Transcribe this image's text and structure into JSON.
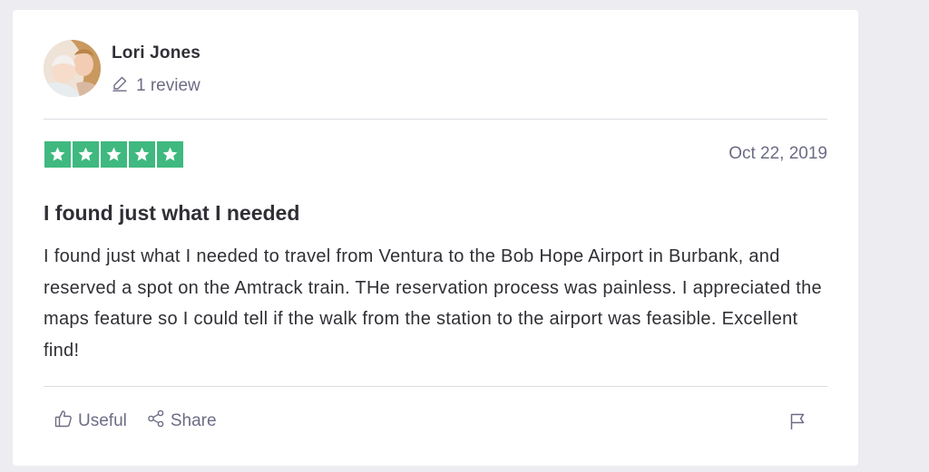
{
  "reviewer": {
    "name": "Lori Jones",
    "review_count": "1 review"
  },
  "rating": {
    "stars": 5,
    "max_stars": 5,
    "color": "#3fb97f"
  },
  "review": {
    "date": "Oct 22, 2019",
    "title": "I found just what I needed",
    "body": "I found just what I needed to travel from Ventura to the Bob Hope Airport in Burbank, and reserved a spot on the Amtrack train. THe reservation process was painless. I appreciated the maps feature so I could tell if the walk from the station to the airport was feasible. Excellent find!"
  },
  "actions": {
    "useful_label": "Useful",
    "share_label": "Share"
  },
  "icons": {
    "review_count": "pencil-icon",
    "useful": "thumbs-up-icon",
    "share": "share-icon",
    "report": "flag-icon"
  }
}
